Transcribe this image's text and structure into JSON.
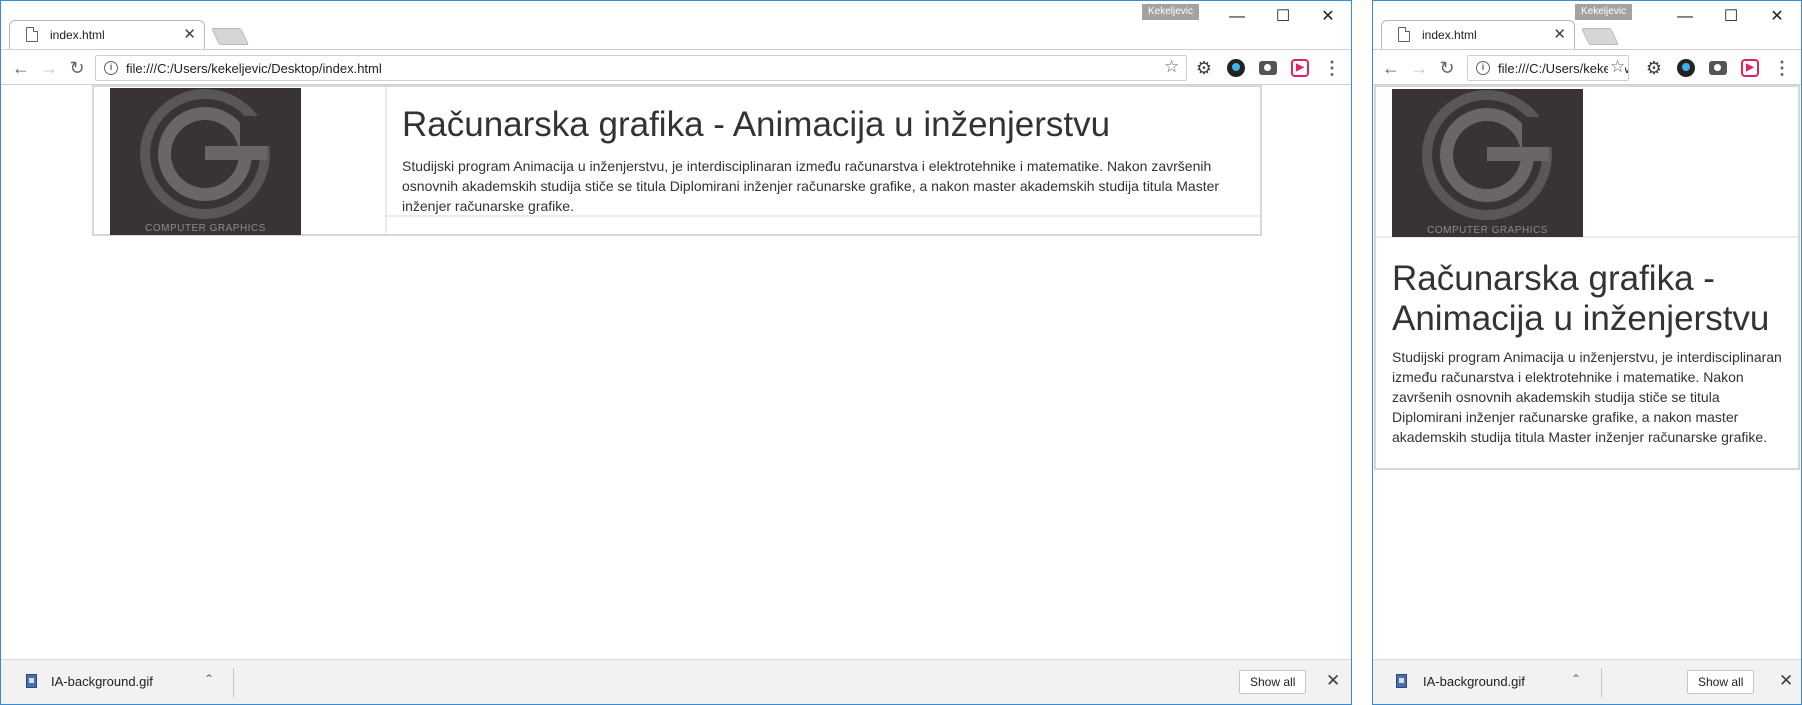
{
  "browser": {
    "profile_name": "Kekeljevic",
    "tab_title": "index.html",
    "tab_close_glyph": "✕",
    "url_full": "file:///C:/Users/kekeljevic/Desktop/index.html",
    "url_truncated": "file:///C:/Users/kekeljevic/Desktop/index.html",
    "window_controls": {
      "minimize": "—",
      "maximize": "☐",
      "close": "✕"
    },
    "nav": {
      "back": "←",
      "forward": "→",
      "reload": "↻"
    },
    "info_glyph": "i",
    "bookmark_star": "☆",
    "extensions": [
      "gear-icon",
      "globe-extension-icon",
      "camera-extension-icon",
      "red-extension-icon"
    ],
    "menu_glyph": "⋮"
  },
  "page": {
    "logo": {
      "caption": "COMPUTER GRAPHICS",
      "background": "#3a3334"
    },
    "heading": "Računarska grafika - Animacija u inženjerstvu",
    "description": "Studijski program Animacija u inženjerstvu, je interdisciplinaran između računarstva i elektrotehnike i matematike. Nakon završenih osnovnih akademskih studija stiče se titula Diplomirani inženjer računarske grafike, a nakon master akademskih studija titula Master inženjer računarske grafike."
  },
  "downloads_bar": {
    "file_name": "IA-background.gif",
    "chevron": "⌃",
    "show_all_label": "Show all",
    "close_glyph": "✕"
  },
  "colors": {
    "window_border": "#3a8ad6",
    "text": "#333333",
    "logo_bg": "#3a3334",
    "table_border": "#d7d7d7"
  }
}
